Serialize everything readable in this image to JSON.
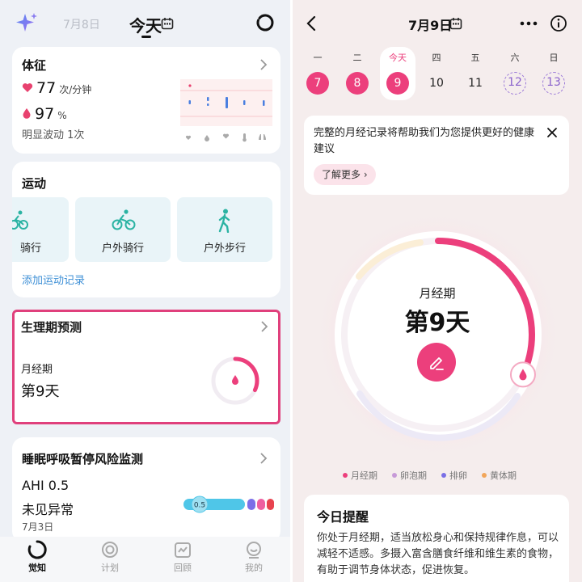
{
  "left": {
    "header": {
      "prev_date": "7月8日",
      "title": "今天"
    },
    "vitals": {
      "title": "体征",
      "heart_rate": {
        "value": "77",
        "unit": "次/分钟"
      },
      "spo2": {
        "value": "97",
        "unit": "%"
      },
      "fluctuation": "明显波动 1次"
    },
    "sport": {
      "title": "运动",
      "tiles": [
        {
          "label": "骑行"
        },
        {
          "label": "户外骑行"
        },
        {
          "label": "户外步行"
        }
      ],
      "add_link": "添加运动记录"
    },
    "period": {
      "title": "生理期预测",
      "label": "月经期",
      "day": "第9天",
      "progress": 0.32
    },
    "sleep": {
      "title": "睡眠呼吸暂停风险监测",
      "ahi": "AHI 0.5",
      "status": "未见异常",
      "date": "7月3日",
      "bar_value": "0.5"
    },
    "tabs": [
      {
        "label": "觉知",
        "active": true
      },
      {
        "label": "计划",
        "active": false
      },
      {
        "label": "回顾",
        "active": false
      },
      {
        "label": "我的",
        "active": false
      }
    ]
  },
  "right": {
    "header": {
      "date": "7月9日"
    },
    "week": [
      {
        "label": "一",
        "day": "7",
        "state": "period"
      },
      {
        "label": "二",
        "day": "8",
        "state": "period"
      },
      {
        "label": "今天",
        "day": "9",
        "state": "period-today"
      },
      {
        "label": "四",
        "day": "10",
        "state": "normal"
      },
      {
        "label": "五",
        "day": "11",
        "state": "normal"
      },
      {
        "label": "六",
        "day": "12",
        "state": "predicted"
      },
      {
        "label": "日",
        "day": "13",
        "state": "predicted"
      }
    ],
    "tip": {
      "text": "完整的月经记录将帮助我们为您提供更好的健康建议",
      "button": "了解更多 ›"
    },
    "cycle": {
      "label": "月经期",
      "day": "第9天",
      "progress": 0.32
    },
    "legend": [
      {
        "label": "月经期",
        "color": "#ec3f7c"
      },
      {
        "label": "卵泡期",
        "color": "#c79ad8"
      },
      {
        "label": "排卵",
        "color": "#7a6fe6"
      },
      {
        "label": "黄体期",
        "color": "#f2a65a"
      }
    ],
    "reminder": {
      "title": "今日提醒",
      "text": "你处于月经期，适当放松身心和保持规律作息，可以减轻不适感。多摄入富含膳食纤维和维生素的食物，有助于调节身体状态，促进恢复。"
    }
  }
}
